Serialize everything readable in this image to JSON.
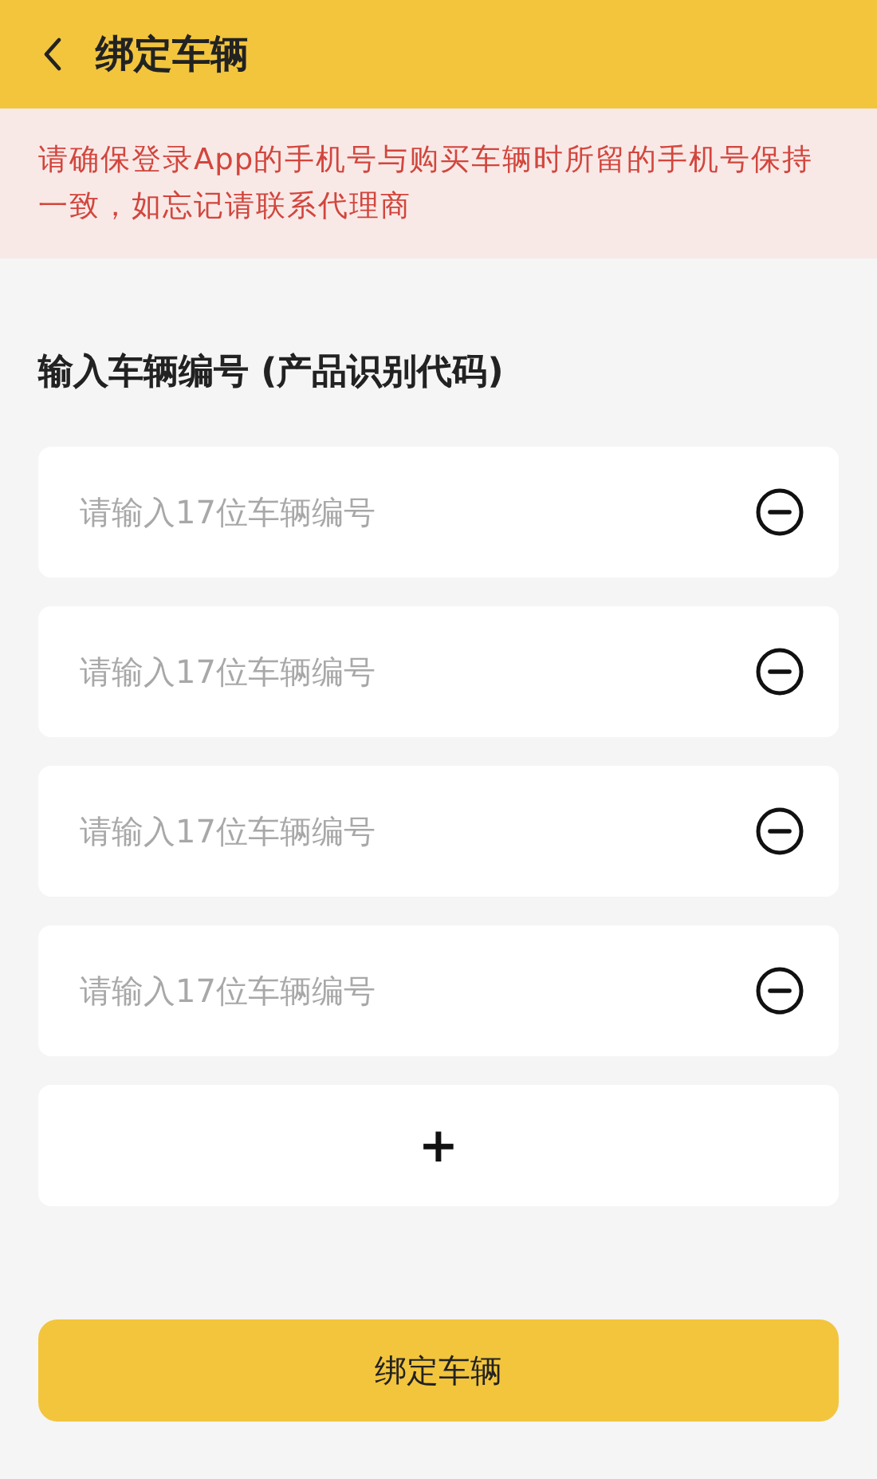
{
  "header": {
    "title": "绑定车辆"
  },
  "notice": "请确保登录App的手机号与购买车辆时所留的手机号保持一致，如忘记请联系代理商",
  "section_label": "输入车辆编号 (产品识别代码)",
  "fields": [
    {
      "placeholder": "请输入17位车辆编号"
    },
    {
      "placeholder": "请输入17位车辆编号"
    },
    {
      "placeholder": "请输入17位车辆编号"
    },
    {
      "placeholder": "请输入17位车辆编号"
    }
  ],
  "add_button": "+",
  "submit_button": "绑定车辆"
}
